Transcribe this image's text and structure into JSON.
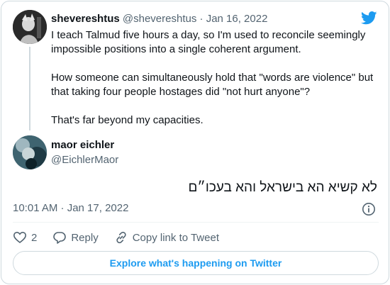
{
  "quoted_tweet": {
    "display_name": "shevereshtus",
    "handle": "@shevereshtus",
    "separator": "·",
    "date": "Jan 16, 2022",
    "text": "I teach Talmud five hours a day, so I'm used to reconcile seemingly impossible positions into a single coherent argument.\n\nHow someone can simultaneously hold that \"words are violence\" but that taking four people hostages did \"not hurt anyone\"?\n\nThat's far beyond my capacities."
  },
  "main_tweet": {
    "display_name": "maor eichler",
    "handle": "@EichlerMaor",
    "text": "לא קשיא הא בישראל והא בעכו״ם",
    "timestamp": "10:01 AM · Jan 17, 2022"
  },
  "actions": {
    "like_count": "2",
    "reply_label": "Reply",
    "copy_link_label": "Copy link to Tweet"
  },
  "footer": {
    "explore_label": "Explore what's happening on Twitter"
  },
  "colors": {
    "accent": "#1d9bf0",
    "secondary_text": "#536471",
    "border": "#cfd9de"
  },
  "icons": [
    "twitter-bird-icon",
    "info-icon",
    "heart-icon",
    "reply-bubble-icon",
    "link-icon"
  ]
}
